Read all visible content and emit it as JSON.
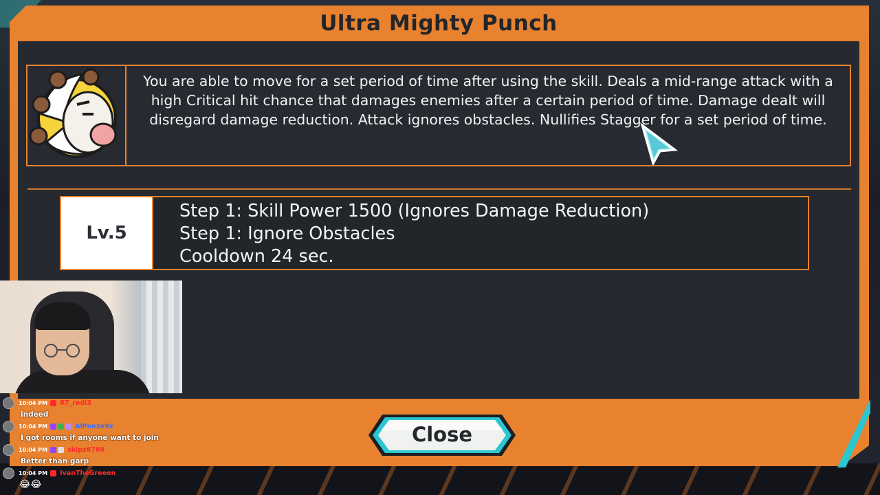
{
  "dialog": {
    "title": "Ultra Mighty Punch",
    "description": "You are able to move for a set period of time after using the skill. Deals a mid-range attack with a high Critical hit chance that damages enemies after a certain period of time. Damage dealt will disregard damage reduction. Attack ignores obstacles. Nullifies Stagger for a set period of time.",
    "level": {
      "tag": "Lv.5",
      "lines": [
        "Step 1: Skill Power 1500 (Ignores Damage Reduction)",
        "Step 1: Ignore Obstacles",
        "Cooldown 24 sec."
      ]
    },
    "close_label": "Close"
  },
  "chat": {
    "messages": [
      {
        "time": "10:04 PM",
        "user": "RT_redi3",
        "text": "indeed"
      },
      {
        "time": "10:04 PM",
        "user": "AlPonzo9x",
        "text": "I got rooms if anyone want to join"
      },
      {
        "time": "10:04 PM",
        "user": "skipz6769",
        "text": "Better than garp"
      },
      {
        "time": "10:04 PM",
        "user": "IvanTheGreeen",
        "text": "😂😂"
      }
    ]
  },
  "colors": {
    "frame_orange": "#e8822f",
    "panel_dark": "#262a30",
    "accent_teal": "#2bc6cf"
  }
}
